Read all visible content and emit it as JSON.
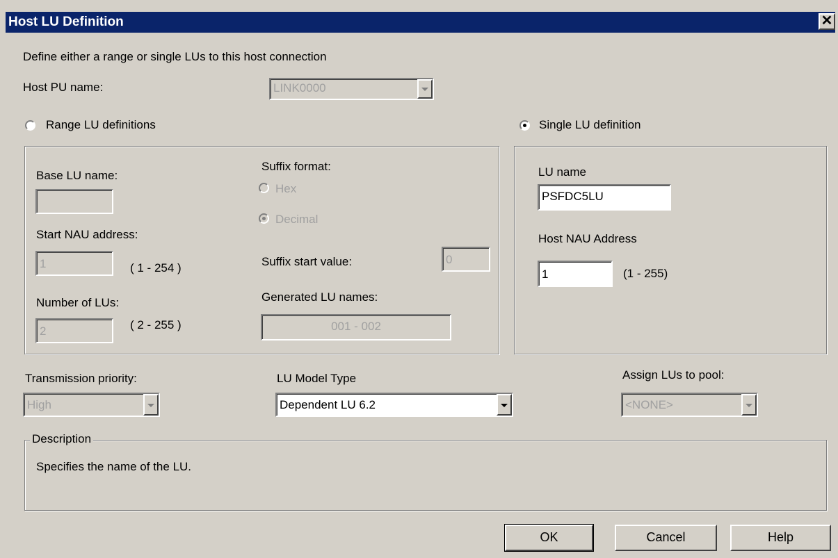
{
  "window": {
    "title": "Host LU Definition",
    "close_label": "✕"
  },
  "intro": "Define either a range or single LUs to this host connection",
  "host_pu": {
    "label": "Host PU name:",
    "value": "LINK0000"
  },
  "range": {
    "radio_label": "Range LU definitions",
    "base_lu": {
      "label": "Base LU name:",
      "value": ""
    },
    "start_nau": {
      "label": "Start NAU address:",
      "value": "1",
      "range": "( 1 - 254 )"
    },
    "num_lus": {
      "label": "Number of LUs:",
      "value": "2",
      "range": "( 2 - 255 )"
    },
    "suffix": {
      "label": "Suffix format:",
      "hex": "Hex",
      "decimal": "Decimal",
      "start_label": "Suffix start value:",
      "start_value": "0"
    },
    "generated": {
      "label": "Generated LU names:",
      "value": "001 - 002"
    }
  },
  "single": {
    "radio_label": "Single LU definition",
    "lu_name": {
      "label": "LU name",
      "value": "PSFDC5LU"
    },
    "nau": {
      "label": "Host NAU Address",
      "value": "1",
      "range": "(1 - 255)"
    }
  },
  "transmission": {
    "label": "Transmission priority:",
    "value": "High"
  },
  "model": {
    "label": "LU Model Type",
    "value": "Dependent LU 6.2"
  },
  "pool": {
    "label": "Assign LUs to pool:",
    "value": "<NONE>"
  },
  "description": {
    "legend": "Description",
    "text": "Specifies the name of the LU."
  },
  "buttons": {
    "ok": "OK",
    "cancel": "Cancel",
    "help": "Help"
  }
}
